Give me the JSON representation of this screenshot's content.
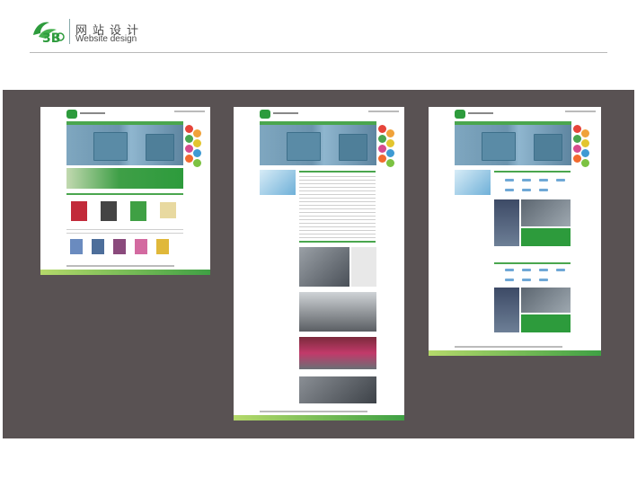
{
  "header": {
    "logo_text": "3B",
    "title_cn": "网站设计",
    "title_en": "Website design"
  },
  "colors": {
    "stage": "#595253",
    "brand_green": "#2d9b3c",
    "accent_blue": "#6fa8d6"
  },
  "mockups": [
    {
      "name": "homepage-mockup"
    },
    {
      "name": "about-page-mockup"
    },
    {
      "name": "equipment-page-mockup"
    }
  ]
}
